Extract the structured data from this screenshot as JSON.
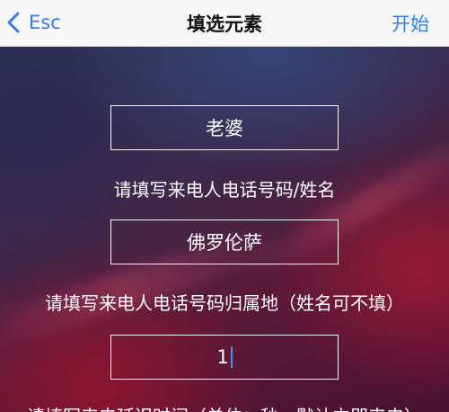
{
  "navbar": {
    "back_label": "Esc",
    "title": "填选元素",
    "start_label": "开始"
  },
  "form": {
    "field1_value": "老婆",
    "hint1": "请填写来电人电话号码/姓名",
    "field2_value": "佛罗伦萨",
    "hint2": "请填写来电人电话号码归属地（姓名可不填）",
    "field3_value": "1",
    "hint3": "请填写来电延迟时间（单位：秒，默认立即来电）"
  },
  "colors": {
    "accent": "#2f7cf6",
    "navbar_bg": "#f7f7f7",
    "text_on_bg": "#ffffff"
  }
}
